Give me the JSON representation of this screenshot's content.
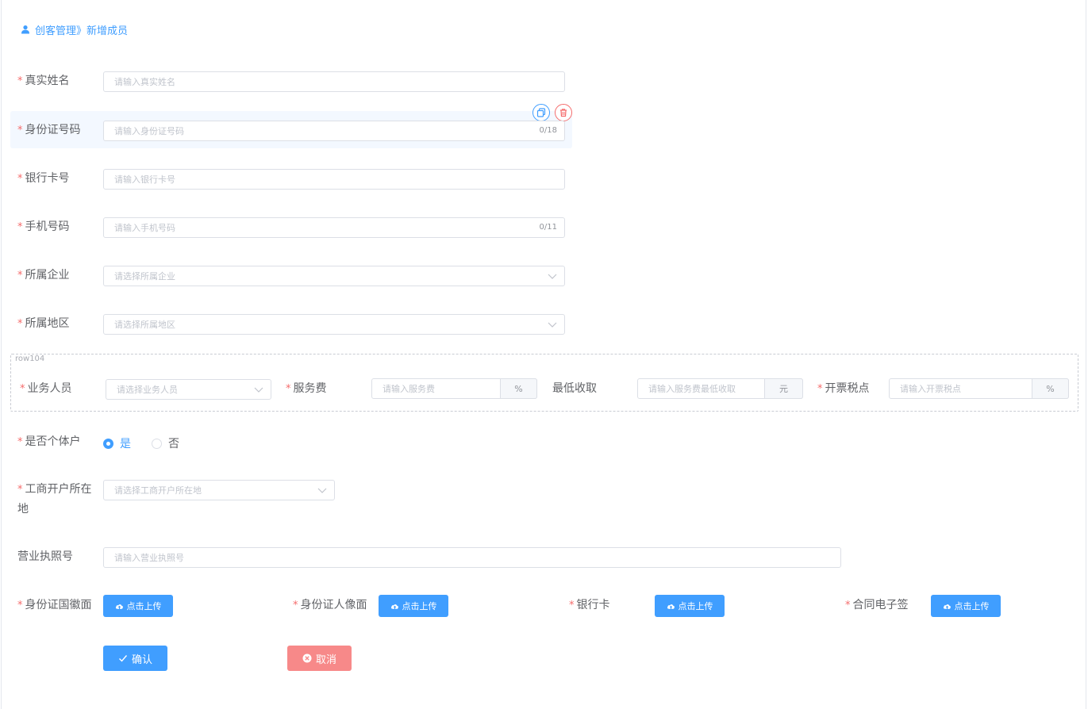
{
  "breadcrumb": {
    "section": "创客管理",
    "sep": "》",
    "page": "新增成员"
  },
  "fields": {
    "real_name": {
      "label": "真实姓名",
      "placeholder": "请输入真实姓名"
    },
    "id_number": {
      "label": "身份证号码",
      "placeholder": "请输入身份证号码",
      "count": "0/18"
    },
    "bank_card": {
      "label": "银行卡号",
      "placeholder": "请输入银行卡号"
    },
    "phone": {
      "label": "手机号码",
      "placeholder": "请输入手机号码",
      "count": "0/11"
    },
    "company": {
      "label": "所属企业",
      "placeholder": "请选择所属企业"
    },
    "region": {
      "label": "所属地区",
      "placeholder": "请选择所属地区"
    }
  },
  "row104": {
    "tag": "row104",
    "salesperson": {
      "label": "业务人员",
      "placeholder": "请选择业务人员"
    },
    "service_fee": {
      "label": "服务费",
      "placeholder": "请输入服务费",
      "unit": "%"
    },
    "min_charge": {
      "label": "最低收取",
      "placeholder": "请输入服务费最低收取",
      "unit": "元"
    },
    "tax_point": {
      "label": "开票税点",
      "placeholder": "请输入开票税点",
      "unit": "%"
    }
  },
  "individual": {
    "label": "是否个体户",
    "options": [
      "是",
      "否"
    ],
    "selected": "是"
  },
  "business_location": {
    "label_line1": "工商开户所在",
    "label_line2": "地",
    "placeholder": "请选择工商开户所在地"
  },
  "license": {
    "label": "营业执照号",
    "placeholder": "请输入营业执照号"
  },
  "uploads": {
    "button_label": "点击上传",
    "id_front": "身份证国徽面",
    "id_portrait": "身份证人像面",
    "bank_card": "银行卡",
    "contract": "合同电子签"
  },
  "actions": {
    "confirm": "确认",
    "cancel": "取消"
  },
  "required_mark": "*",
  "colors": {
    "primary": "#409eff",
    "danger": "#f56c6c",
    "selected_row": "#f3f8ff"
  }
}
